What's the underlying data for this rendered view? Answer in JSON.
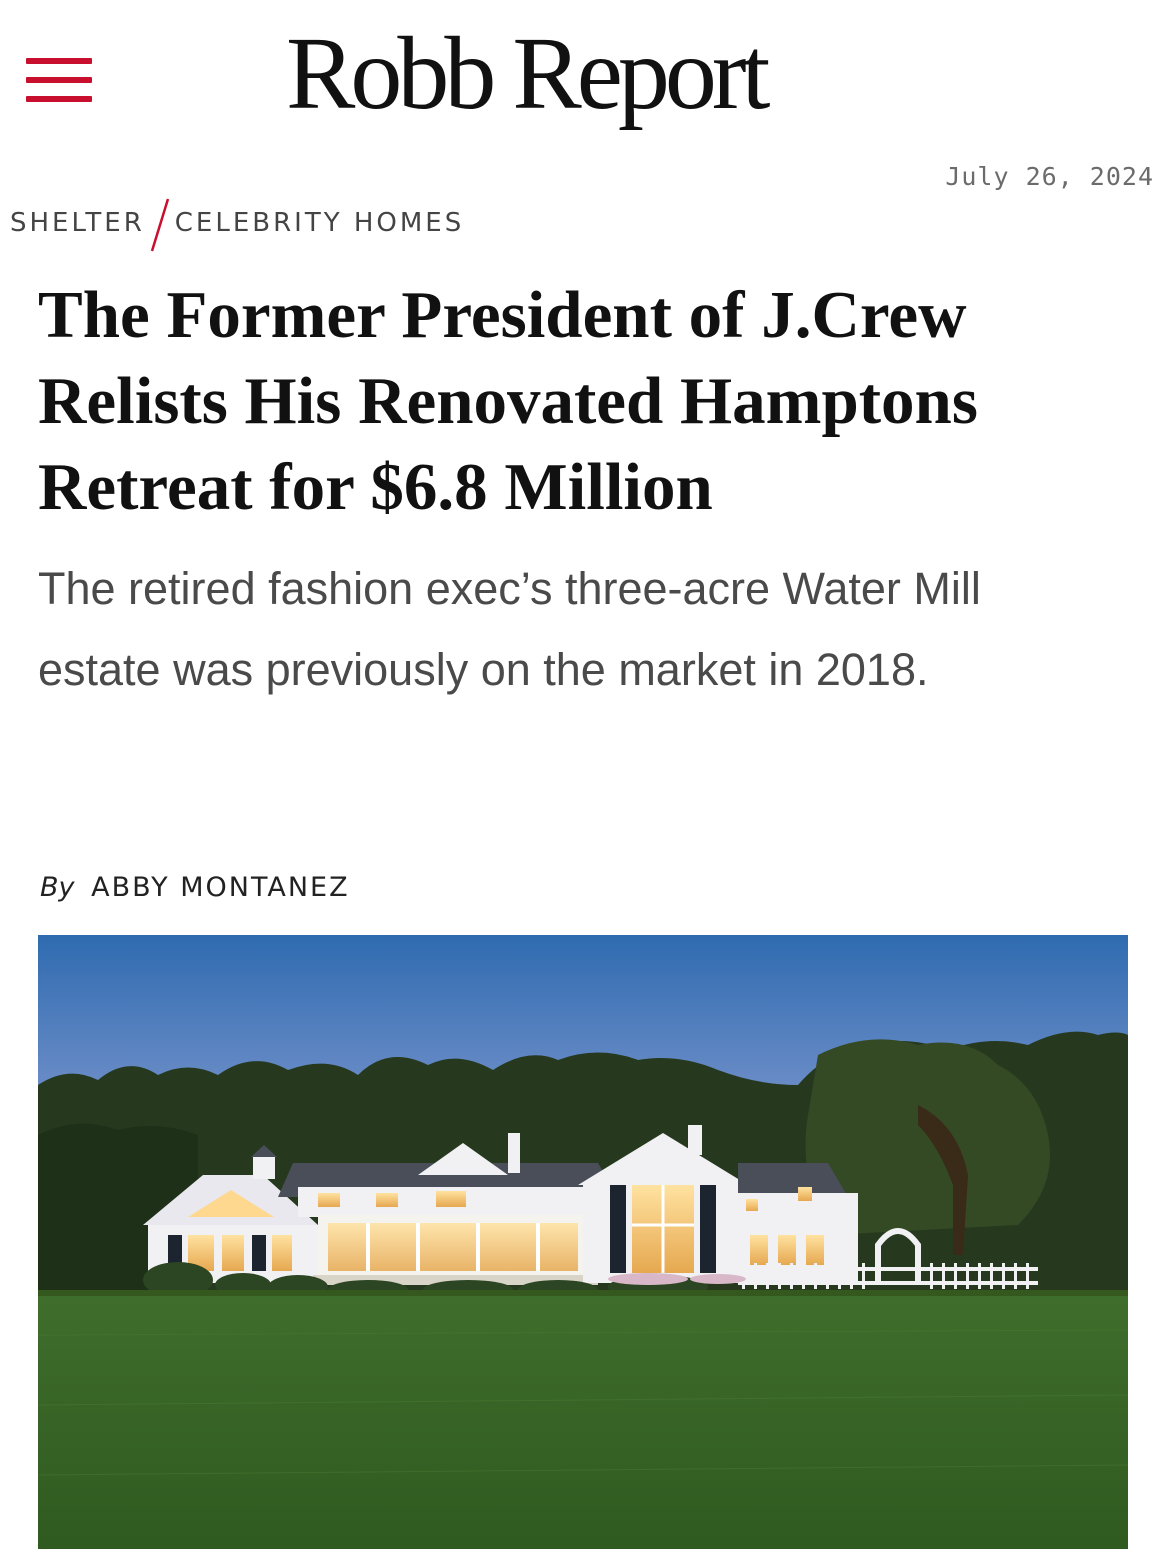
{
  "header": {
    "menu_icon": "hamburger-menu-icon",
    "logo_text": "Robb Report",
    "accent_color": "#c8102e"
  },
  "article": {
    "date": "July 26, 2024",
    "breadcrumb": {
      "section": "SHELTER",
      "subsection": "CELEBRITY HOMES"
    },
    "headline": "The Former President of J.Crew Relists His Renovated Hamptons Retreat for $6.8 Million",
    "dek": "The retired fashion exec’s three-acre Water Mill estate was previously on the market in 2018.",
    "byline": {
      "prefix": "By",
      "author": "ABBY MONTANEZ"
    },
    "hero_image": "hamptons-estate-dusk-photo"
  }
}
